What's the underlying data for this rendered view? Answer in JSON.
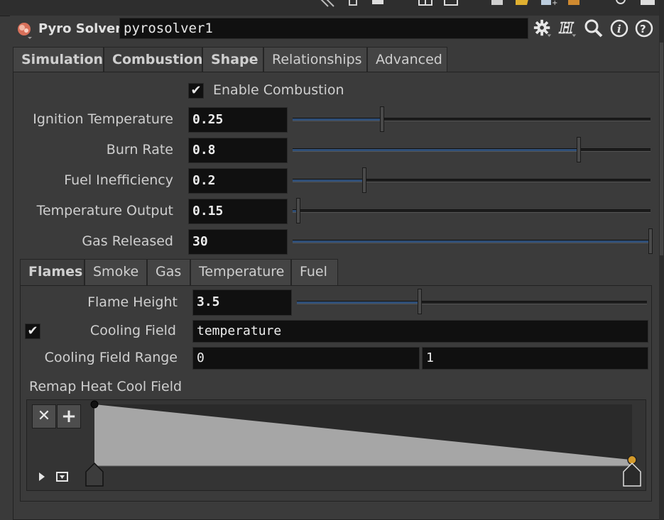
{
  "node": {
    "type_label": "Pyro Solver",
    "name_value": "pyrosolver1"
  },
  "tabs": [
    {
      "label": "Simulation"
    },
    {
      "label": "Combustion"
    },
    {
      "label": "Shape"
    },
    {
      "label": "Relationships"
    },
    {
      "label": "Advanced"
    }
  ],
  "combustion": {
    "enable_label": "Enable Combustion",
    "enable_checked": true,
    "params": [
      {
        "label": "Ignition Temperature",
        "value": "0.25",
        "slider_fraction": 0.25
      },
      {
        "label": "Burn Rate",
        "value": "0.8",
        "slider_fraction": 0.8
      },
      {
        "label": "Fuel Inefficiency",
        "value": "0.2",
        "slider_fraction": 0.2
      },
      {
        "label": "Temperature Output",
        "value": "0.15",
        "slider_fraction": 0.015
      },
      {
        "label": "Gas Released",
        "value": "30",
        "slider_fraction": 1.0
      }
    ]
  },
  "subtabs": [
    {
      "label": "Flames"
    },
    {
      "label": "Smoke"
    },
    {
      "label": "Gas"
    },
    {
      "label": "Temperature"
    },
    {
      "label": "Fuel"
    }
  ],
  "flames": {
    "flame_height_label": "Flame Height",
    "flame_height_value": "3.5",
    "flame_height_fraction": 0.35,
    "cooling_field_label": "Cooling Field",
    "cooling_field_checked": true,
    "cooling_field_value": "temperature",
    "cooling_range_label": "Cooling Field Range",
    "cooling_range_min": "0",
    "cooling_range_max": "1",
    "remap_label": "Remap Heat Cool Field",
    "ramp_points": [
      {
        "pos": 0.0,
        "value": 1.0
      },
      {
        "pos": 1.0,
        "value": 0.1
      }
    ]
  },
  "colors": {
    "ramp_fill": "#a6a6a6",
    "selected_point": "#d49a2a",
    "slider_fill": "#2f4f78"
  }
}
